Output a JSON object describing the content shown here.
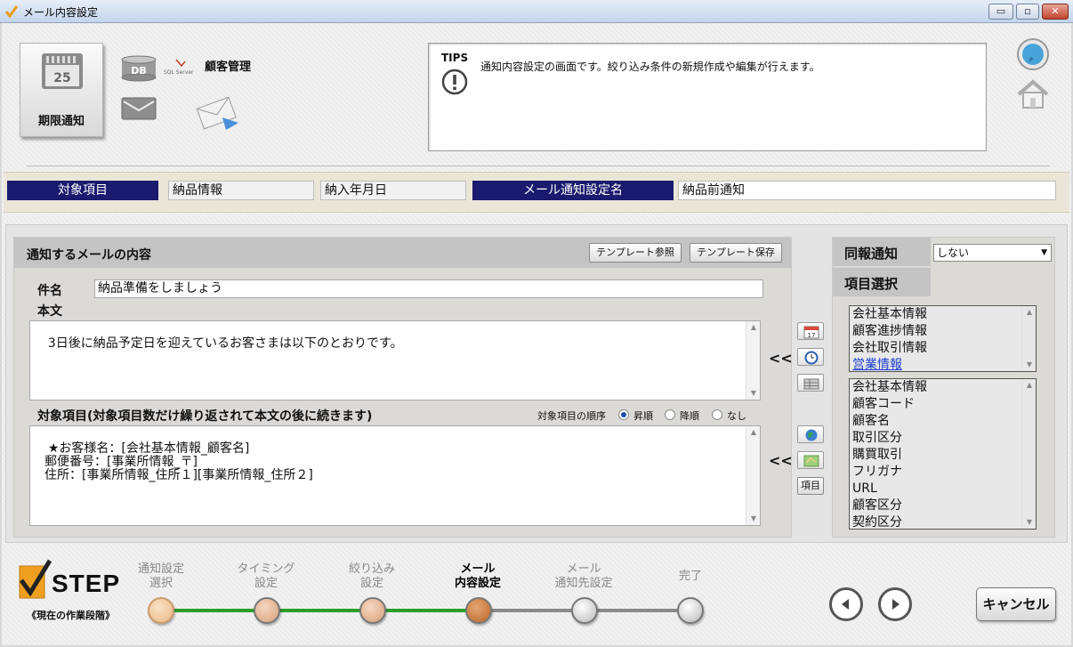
{
  "window": {
    "title": "メール内容設定",
    "min": "▭",
    "max": "▫",
    "close": "✕"
  },
  "header": {
    "deadline_label": "期限通知",
    "calendar_day": "25",
    "db_text": "DB",
    "sql_text": "SQL Server",
    "crm_label": "顧客管理",
    "tips_head": "TIPS",
    "tips_text": "通知内容設定の画面です。絞り込み条件の新規作成や編集が行えます。"
  },
  "infobar": {
    "target_label": "対象項目",
    "target_value1": "納品情報",
    "target_value2": "納入年月日",
    "setting_name_label": "メール通知設定名",
    "setting_name_value": "納品前通知"
  },
  "content": {
    "title": "通知するメールの内容",
    "template_ref": "テンプレート参照",
    "template_save": "テンプレート保存",
    "subject_label": "件名",
    "subject_value": "納品準備をしましょう",
    "body_label": "本文",
    "body_value": "3日後に納品予定日を迎えているお客さまは以下のとおりです。",
    "items_label": "対象項目(対象項目数だけ繰り返されて本文の後に続きます)",
    "order_label": "対象項目の順序",
    "order_options": [
      "昇順",
      "降順",
      "なし"
    ],
    "items_value": "★お客様名：[会社基本情報_顧客名]\n　郵便番号：[事業所情報_〒]\n　住所：[事業所情報_住所１][事業所情報_住所２]",
    "insert_arrows": "<<",
    "item_button": "項目"
  },
  "right": {
    "cc_label": "同報通知",
    "cc_value": "しない",
    "item_select_label": "項目選択",
    "categories": [
      "会社基本情報",
      "顧客進捗情報",
      "会社取引情報",
      "営業情報"
    ],
    "fields": [
      "会社基本情報",
      "顧客コード",
      "顧客名",
      "取引区分",
      "購買取引",
      "フリガナ",
      "URL",
      "顧客区分",
      "契約区分"
    ]
  },
  "steps": {
    "logo_word": "STEP",
    "logo_sub": "《現在の作業段階》",
    "items": [
      {
        "line1": "通知設定",
        "line2": "選択"
      },
      {
        "line1": "タイミング",
        "line2": "設定"
      },
      {
        "line1": "絞り込み",
        "line2": "設定"
      },
      {
        "line1": "メール",
        "line2": "内容設定"
      },
      {
        "line1": "メール",
        "line2": "通知先設定"
      },
      {
        "line1": "完了",
        "line2": ""
      }
    ],
    "current_index": 3,
    "cancel_label": "キャンセル"
  },
  "colors": {
    "nav_label_bg": "#1a1a6e",
    "step_done": "#e8b988",
    "step_current": "#b8672a",
    "step_pending": "#c0c0c0",
    "step_line_done": "#2e9d2a",
    "link_selected": "#1a3ccf"
  }
}
